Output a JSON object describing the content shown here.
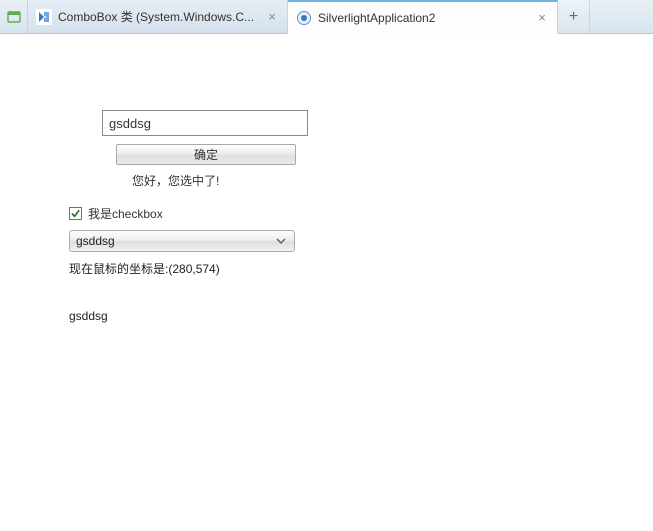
{
  "tabs": {
    "items": [
      {
        "title": "ComboBox 类 (System.Windows.C...",
        "active": false,
        "favicon": "ms-docs"
      },
      {
        "title": "SilverlightApplication2",
        "active": true,
        "favicon": "silverlight"
      }
    ]
  },
  "form": {
    "text_value": "gsddsg",
    "confirm_label": "确定",
    "greeting": "您好，您选中了!"
  },
  "checkbox": {
    "checked": true,
    "label": "我是checkbox"
  },
  "combobox": {
    "selected": "gsddsg"
  },
  "coords": {
    "prefix": "现在鼠标的坐标是:",
    "value": "(280,574)"
  },
  "output": {
    "text": "gsddsg"
  }
}
